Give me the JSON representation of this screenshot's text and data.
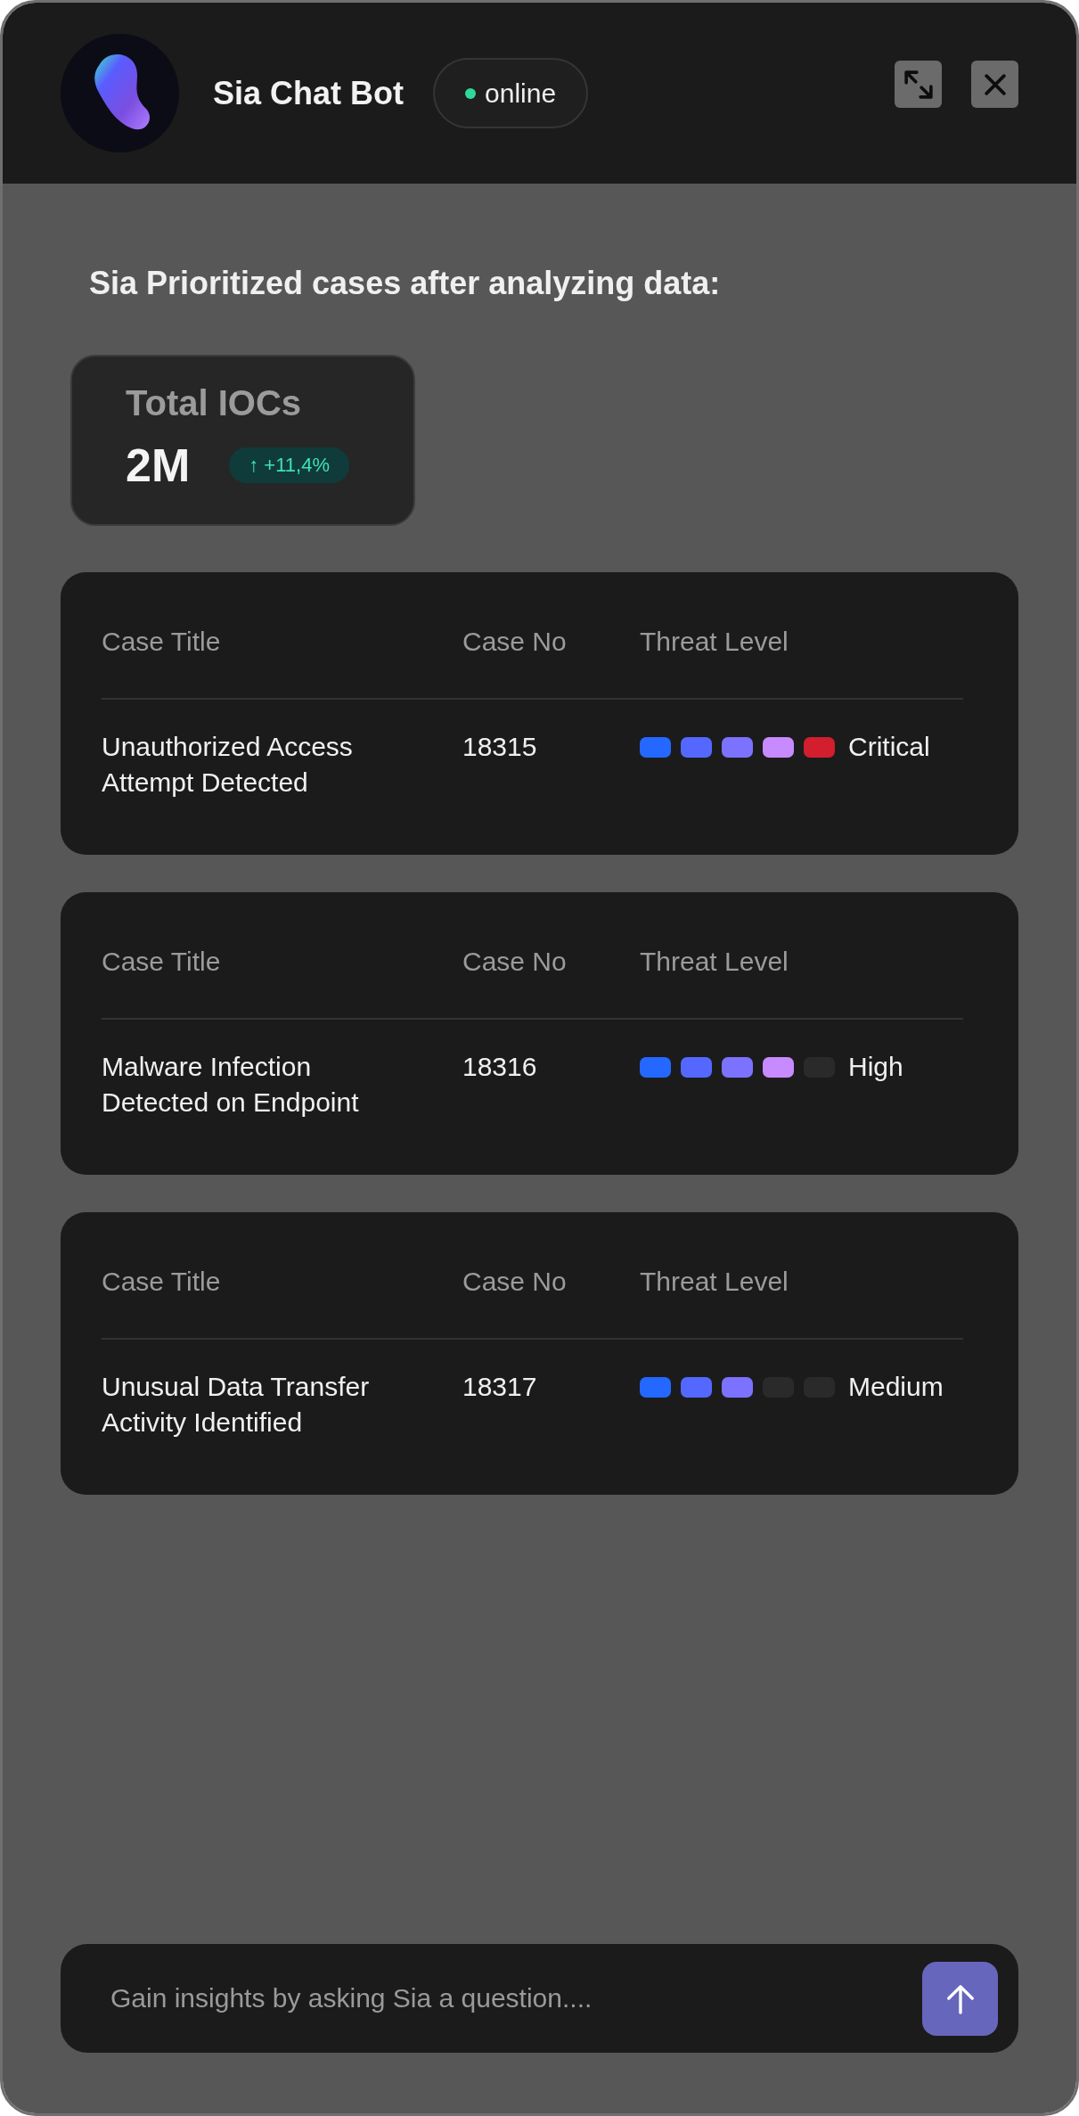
{
  "header": {
    "title": "Sia Chat Bot",
    "status": {
      "label": "online",
      "online": true
    }
  },
  "heading": "Sia Prioritized cases after analyzing data:",
  "stat_card": {
    "label": "Total IOCs",
    "value": "2M",
    "change": "↑ +11,4%"
  },
  "cases": [
    {
      "columns": [
        "Case Title",
        "Case No",
        "Threat Level"
      ],
      "title": "Unauthorized Access Attempt Detected",
      "case_no": "18315",
      "threat": {
        "label": "Critical",
        "segments": [
          {
            "on": true,
            "color": "#2468ff"
          },
          {
            "on": true,
            "color": "#5468ff"
          },
          {
            "on": true,
            "color": "#7b72ff"
          },
          {
            "on": true,
            "color": "#c88aff"
          },
          {
            "on": true,
            "color": "#d31e2d"
          }
        ]
      }
    },
    {
      "columns": [
        "Case Title",
        "Case No",
        "Threat Level"
      ],
      "title": "Malware Infection Detected on Endpoint",
      "case_no": "18316",
      "threat": {
        "label": "High",
        "segments": [
          {
            "on": true,
            "color": "#2468ff"
          },
          {
            "on": true,
            "color": "#5468ff"
          },
          {
            "on": true,
            "color": "#7b72ff"
          },
          {
            "on": true,
            "color": "#c88aff"
          },
          {
            "on": false
          }
        ]
      }
    },
    {
      "columns": [
        "Case Title",
        "Case No",
        "Threat Level"
      ],
      "title": "Unusual Data Transfer Activity Identified",
      "case_no": "18317",
      "threat": {
        "label": "Medium",
        "segments": [
          {
            "on": true,
            "color": "#2468ff"
          },
          {
            "on": true,
            "color": "#5468ff"
          },
          {
            "on": true,
            "color": "#7b72ff"
          },
          {
            "on": false
          },
          {
            "on": false
          }
        ]
      }
    }
  ],
  "composer": {
    "placeholder": "Gain insights by asking Sia a question...."
  }
}
